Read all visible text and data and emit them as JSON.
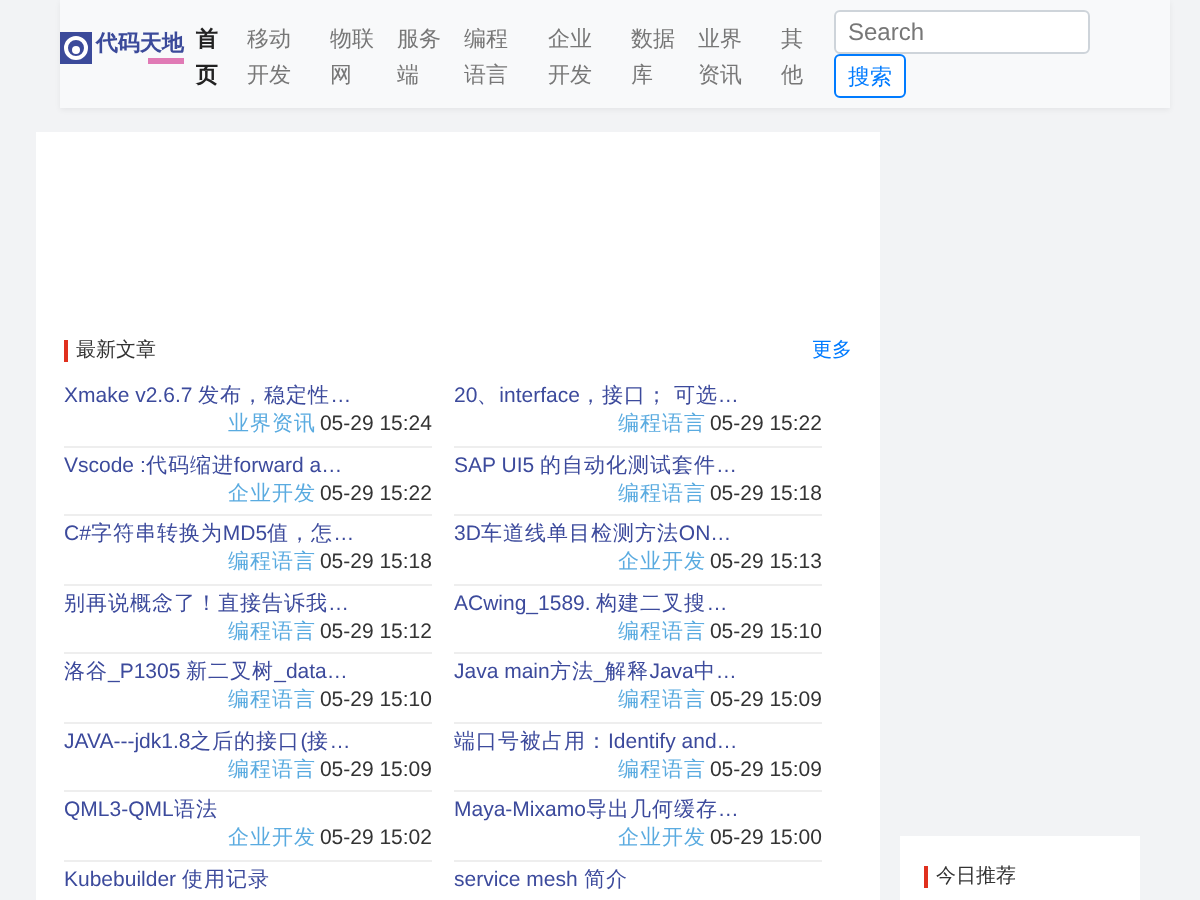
{
  "header": {
    "logo": {
      "text": "代码天地"
    },
    "nav": [
      {
        "label": "首页",
        "selected": true
      },
      {
        "label": "移动开发",
        "selected": false
      },
      {
        "label": "物联网",
        "selected": false
      },
      {
        "label": "服务端",
        "selected": false
      },
      {
        "label": "编程语言",
        "selected": false
      },
      {
        "label": "企业开发",
        "selected": false
      },
      {
        "label": "数据库",
        "selected": false
      },
      {
        "label": "业界资讯",
        "selected": false
      },
      {
        "label": "其他",
        "selected": false
      }
    ],
    "search": {
      "placeholder": "Search",
      "button": "搜索"
    }
  },
  "latest": {
    "title": "最新文章",
    "more": "更多",
    "articles": [
      {
        "title": "Xmake v2.6.7 发布，稳定性…",
        "category": "业界资讯",
        "time": "05-29 15:24"
      },
      {
        "title": "20、interface，接口； 可选…",
        "category": "编程语言",
        "time": "05-29 15:22"
      },
      {
        "title": "Vscode :代码缩进forward a…",
        "category": "企业开发",
        "time": "05-29 15:22"
      },
      {
        "title": "SAP UI5 的自动化测试套件…",
        "category": "编程语言",
        "time": "05-29 15:18"
      },
      {
        "title": "C#字符串转换为MD5值，怎…",
        "category": "编程语言",
        "time": "05-29 15:18"
      },
      {
        "title": "3D车道线单目检测方法ON…",
        "category": "企业开发",
        "time": "05-29 15:13"
      },
      {
        "title": "别再说概念了！直接告诉我…",
        "category": "编程语言",
        "time": "05-29 15:12"
      },
      {
        "title": "ACwing_1589. 构建二叉搜…",
        "category": "编程语言",
        "time": "05-29 15:10"
      },
      {
        "title": "洛谷_P1305 新二叉树_data…",
        "category": "编程语言",
        "time": "05-29 15:10"
      },
      {
        "title": "Java main方法_解释Java中…",
        "category": "编程语言",
        "time": "05-29 15:09"
      },
      {
        "title": "JAVA---jdk1.8之后的接口(接…",
        "category": "编程语言",
        "time": "05-29 15:09"
      },
      {
        "title": "端口号被占用：Identify and…",
        "category": "编程语言",
        "time": "05-29 15:09"
      },
      {
        "title": "QML3-QML语法",
        "category": "企业开发",
        "time": "05-29 15:02"
      },
      {
        "title": "Maya-Mixamo导出几何缓存…",
        "category": "企业开发",
        "time": "05-29 15:00"
      },
      {
        "title": "Kubebuilder 使用记录"
      },
      {
        "title": "service mesh 简介"
      }
    ]
  },
  "sidebar": {
    "title": "今日推荐"
  }
}
